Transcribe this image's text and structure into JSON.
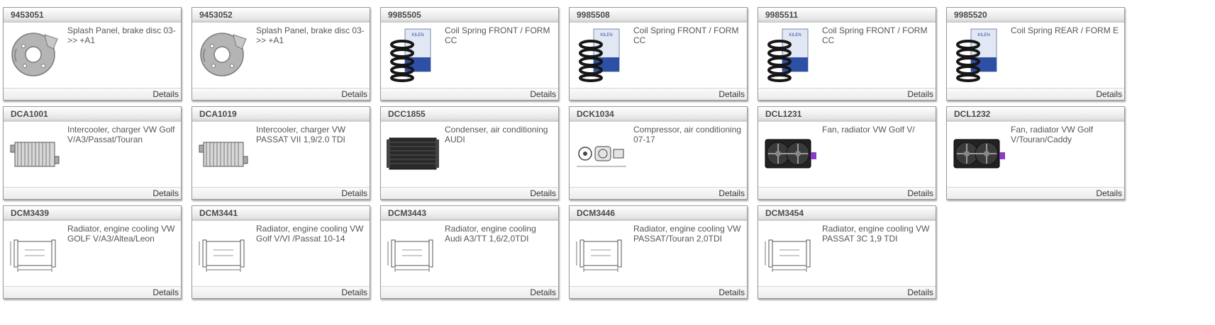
{
  "details_label": "Details",
  "products": [
    {
      "code": "9453051",
      "desc": "Splash Panel, brake disc 03->> +A1",
      "image": "splash-panel"
    },
    {
      "code": "9453052",
      "desc": "Splash Panel, brake disc 03->> +A1",
      "image": "splash-panel"
    },
    {
      "code": "9985505",
      "desc": "Coil Spring FRONT / FORM CC",
      "image": "coil-spring"
    },
    {
      "code": "9985508",
      "desc": "Coil Spring FRONT / FORM CC",
      "image": "coil-spring"
    },
    {
      "code": "9985511",
      "desc": "Coil Spring FRONT / FORM CC",
      "image": "coil-spring"
    },
    {
      "code": "9985520",
      "desc": "Coil Spring REAR / FORM E",
      "image": "coil-spring"
    },
    {
      "code": "DCA1001",
      "desc": "Intercooler, charger VW Golf V/A3/Passat/Touran",
      "image": "intercooler"
    },
    {
      "code": "DCA1019",
      "desc": "Intercooler, charger VW PASSAT VII 1,9/2.0 TDI",
      "image": "intercooler"
    },
    {
      "code": "DCC1855",
      "desc": "Condenser, air conditioning AUDI",
      "image": "condenser"
    },
    {
      "code": "DCK1034",
      "desc": "Compressor, air conditioning 07-17",
      "image": "compressor"
    },
    {
      "code": "DCL1231",
      "desc": "Fan, radiator VW Golf V/",
      "image": "fan"
    },
    {
      "code": "DCL1232",
      "desc": "Fan, radiator VW Golf V/Touran/Caddy",
      "image": "fan"
    },
    {
      "code": "DCM3439",
      "desc": "Radiator, engine cooling VW GOLF V/A3/Altea/Leon",
      "image": "radiator-drawing"
    },
    {
      "code": "DCM3441",
      "desc": "Radiator, engine cooling VW Golf V/VI /Passat 10-14",
      "image": "radiator-drawing"
    },
    {
      "code": "DCM3443",
      "desc": "Radiator, engine cooling Audi A3/TT 1,6/2,0TDI",
      "image": "radiator-drawing"
    },
    {
      "code": "DCM3446",
      "desc": "Radiator, engine cooling VW PASSAT/Touran 2,0TDI",
      "image": "radiator-drawing"
    },
    {
      "code": "DCM3454",
      "desc": "Radiator, engine cooling VW PASSAT 3C 1,9 TDI",
      "image": "radiator-drawing"
    }
  ]
}
